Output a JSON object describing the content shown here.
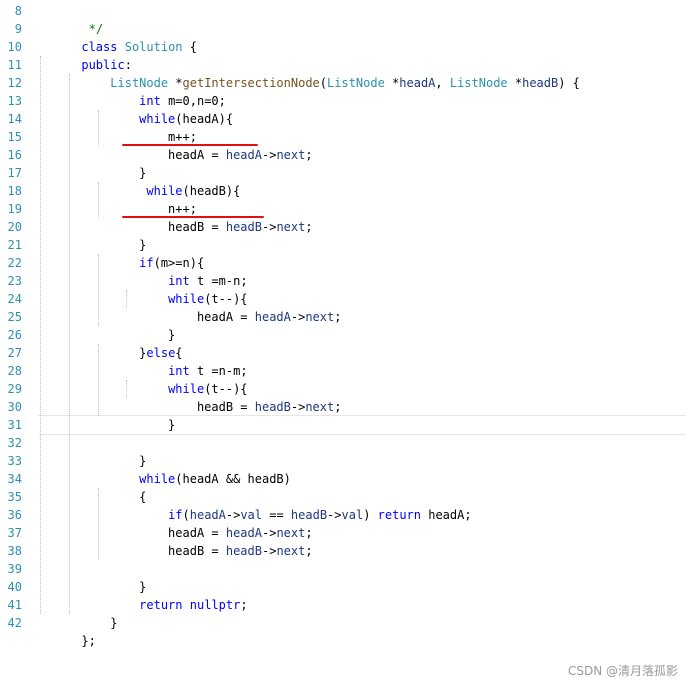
{
  "line_numbers": [
    "8",
    "9",
    "10",
    "11",
    "12",
    "13",
    "14",
    "15",
    "16",
    "17",
    "18",
    "19",
    "20",
    "21",
    "22",
    "23",
    "24",
    "25",
    "26",
    "27",
    "28",
    "29",
    "30",
    "31",
    "32",
    "33",
    "34",
    "35",
    "36",
    "37",
    "38",
    "39",
    "40",
    "41",
    "42"
  ],
  "code": {
    "l8": [
      " ",
      "*/"
    ],
    "l9": [
      "class",
      " ",
      "Solution",
      " {"
    ],
    "l10": [
      "public",
      ":"
    ],
    "l11": [
      "    ",
      "ListNode",
      " *",
      "getIntersectionNode",
      "(",
      "ListNode",
      " *",
      "headA",
      ", ",
      "ListNode",
      " *",
      "headB",
      ") {"
    ],
    "l12": [
      "        ",
      "int",
      " m=0,n=0;"
    ],
    "l13": [
      "        ",
      "while",
      "(headA){"
    ],
    "l14": [
      "            m++;"
    ],
    "l15": [
      "            headA = ",
      "headA",
      "->",
      "next",
      ";"
    ],
    "l16": [
      "        }"
    ],
    "l17": [
      "         ",
      "while",
      "(headB){"
    ],
    "l18": [
      "            n++;"
    ],
    "l19": [
      "            headB = ",
      "headB",
      "->",
      "next",
      ";"
    ],
    "l20": [
      "        }"
    ],
    "l21": [
      "        ",
      "if",
      "(m>=n){"
    ],
    "l22": [
      "            ",
      "int",
      " t =m-n;"
    ],
    "l23": [
      "            ",
      "while",
      "(t--){"
    ],
    "l24": [
      "                headA = ",
      "headA",
      "->",
      "next",
      ";"
    ],
    "l25": [
      "            }"
    ],
    "l26": [
      "        }",
      "else",
      "{"
    ],
    "l27": [
      "            ",
      "int",
      " t =n-m;"
    ],
    "l28": [
      "            ",
      "while",
      "(t--){"
    ],
    "l29": [
      "                headB = ",
      "headB",
      "->",
      "next",
      ";"
    ],
    "l30": [
      "            }"
    ],
    "l31": [
      ""
    ],
    "l32": [
      "        }"
    ],
    "l33": [
      "        ",
      "while",
      "(headA && headB)"
    ],
    "l34": [
      "        {"
    ],
    "l35": [
      "            ",
      "if",
      "(",
      "headA",
      "->",
      "val",
      " == ",
      "headB",
      "->",
      "val",
      ") ",
      "return",
      " headA;"
    ],
    "l36": [
      "            headA = ",
      "headA",
      "->",
      "next",
      ";"
    ],
    "l37": [
      "            headB = ",
      "headB",
      "->",
      "next",
      ";"
    ],
    "l38": [
      ""
    ],
    "l39": [
      "        }"
    ],
    "l40": [
      "        ",
      "return",
      " ",
      "nullptr",
      ";"
    ],
    "l41": [
      "    }"
    ],
    "l42": [
      "};"
    ]
  },
  "watermark": "CSDN @清月落孤影",
  "colors": {
    "keyword": "#0000ff",
    "type": "#2b91af",
    "identifier": "#1f377f",
    "comment": "#008000",
    "line_number": "#2b91af",
    "annotation_underline": "#e01010"
  }
}
